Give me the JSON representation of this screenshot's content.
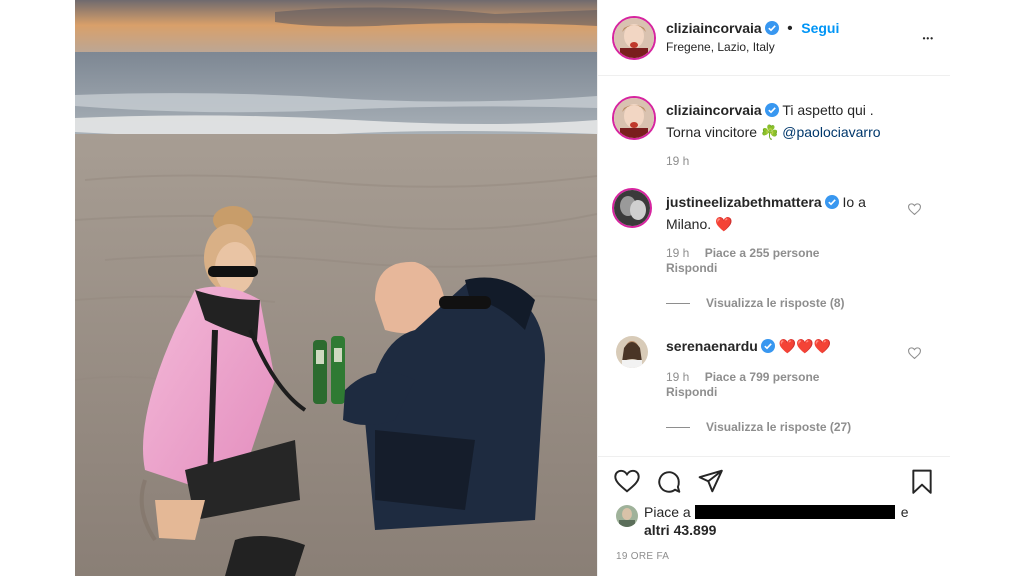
{
  "header": {
    "username": "cliziaincorvaia",
    "dot": "•",
    "follow_label": "Segui",
    "location": "Fregene, Lazio, Italy",
    "more_icon": "more-horizontal-icon",
    "more_label": "•••"
  },
  "caption": {
    "username": "cliziaincorvaia",
    "text1": "Ti aspetto qui .",
    "text2": "Torna vincitore",
    "emoji": "☘️",
    "mention": "@paolociavarro",
    "time": "19 h"
  },
  "comments": [
    {
      "username": "justineelizabethmattera",
      "text1": "Io a",
      "text2": "Milano.",
      "emoji": "❤️",
      "time": "19 h",
      "likes": "Piace a 255 persone",
      "reply": "Rispondi",
      "view_replies": "Visualizza le risposte (8)"
    },
    {
      "username": "serenaenardu",
      "emoji": "❤️❤️❤️",
      "time": "19 h",
      "likes": "Piace a 799 persone",
      "reply": "Rispondi",
      "view_replies": "Visualizza le risposte (27)"
    }
  ],
  "actions": {
    "likes_prefix": "Piace a",
    "likes_suffix": "e",
    "likes_others": "altri 43.899",
    "time_ago": "19 ORE FA"
  },
  "colors": {
    "accent": "#0095f6",
    "verified": "#3897f0",
    "heart": "#ed4956",
    "muted": "#8e8e8e"
  }
}
